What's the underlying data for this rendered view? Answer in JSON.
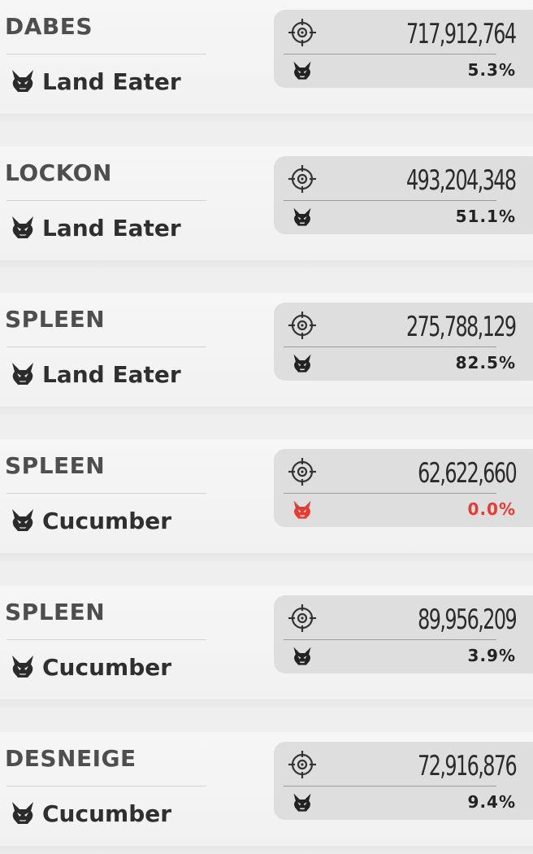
{
  "colors": {
    "alert_red": "#e63a33",
    "card_bg": "#dedede",
    "text_dark": "#2b2b2b",
    "name_gray": "#4e4e4e"
  },
  "icons": {
    "target": "crosshair-target-icon",
    "boss": "demon-skull-icon"
  },
  "entries": [
    {
      "player": "DABES",
      "boss": "Land Eater",
      "damage": "717,912,764",
      "percent": "5.3%",
      "alert": false
    },
    {
      "player": "LOCKON",
      "boss": "Land Eater",
      "damage": "493,204,348",
      "percent": "51.1%",
      "alert": false
    },
    {
      "player": "SPLEEN",
      "boss": "Land Eater",
      "damage": "275,788,129",
      "percent": "82.5%",
      "alert": false
    },
    {
      "player": "SPLEEN",
      "boss": "Cucumber",
      "damage": "62,622,660",
      "percent": "0.0%",
      "alert": true
    },
    {
      "player": "SPLEEN",
      "boss": "Cucumber",
      "damage": "89,956,209",
      "percent": "3.9%",
      "alert": false
    },
    {
      "player": "DESNEIGE",
      "boss": "Cucumber",
      "damage": "72,916,876",
      "percent": "9.4%",
      "alert": false
    }
  ]
}
